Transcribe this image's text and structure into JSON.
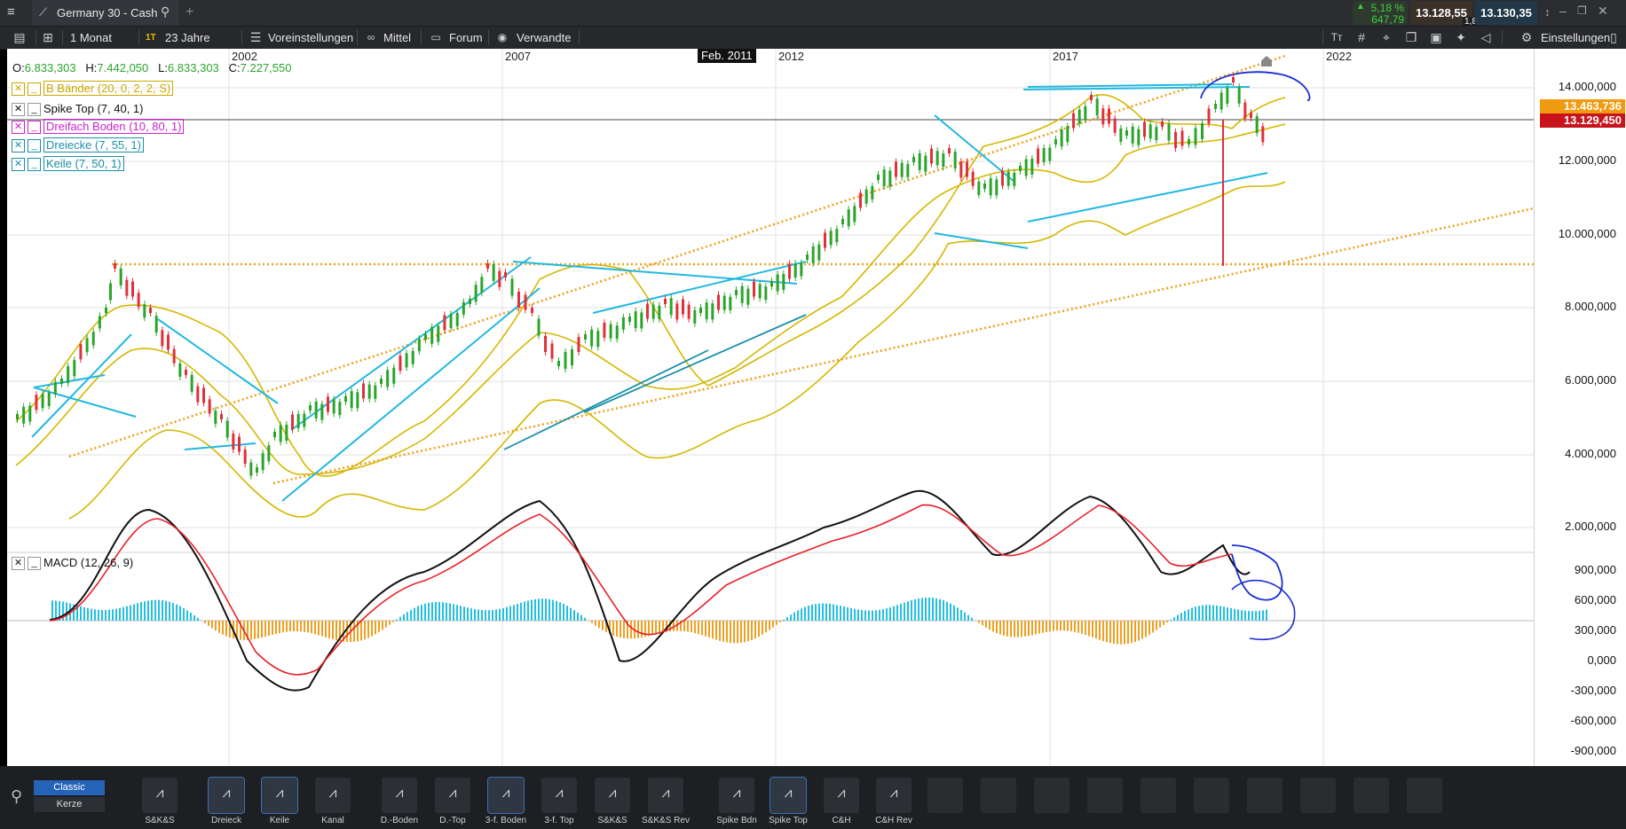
{
  "title_bar": {
    "menu_icon": "hamburger-icon",
    "chart_icon": "line-chart-icon",
    "instrument": "Germany 30 - Cash",
    "search_icon": "search-icon",
    "add_tab_icon": "plus-icon",
    "change_pct": "5,18 %",
    "change_abs": "647,79",
    "bid": "13.128,55",
    "ask": "13.130,35",
    "spread": "1,80",
    "window_controls": [
      "minimize-icon",
      "restore-icon",
      "close-icon"
    ]
  },
  "toolbar": {
    "interval": "1 Monat",
    "range_badge": "1T",
    "range": "23 Jahre",
    "presets": "Voreinstellungen",
    "average": "Mittel",
    "forum": "Forum",
    "related": "Verwandte",
    "settings": "Einstellungen"
  },
  "chart": {
    "ohlc": {
      "o_label": "O:",
      "o": "6.833,303",
      "h_label": "H:",
      "h": "7.442,050",
      "l_label": "L:",
      "l": "6.833,303",
      "c_label": "C:",
      "c": "7.227,550"
    },
    "cursor_date": "Feb. 2011",
    "x_ticks": [
      "2002",
      "2007",
      "2012",
      "2017",
      "2022"
    ],
    "y_ticks": [
      "14.000,000",
      "12.000,000",
      "10.000,000",
      "8.000,000",
      "6.000,000",
      "4.000,000",
      "2.000,000"
    ],
    "price_tags": {
      "upper_band": "13.463,736",
      "last": "13.129,450"
    },
    "indicators": [
      {
        "label": "B Bänder (20, 0, 2, 2, S)",
        "color": "#c9a800"
      },
      {
        "label": "Spike Top (7, 40, 1)",
        "color": "#111111"
      },
      {
        "label": "Dreifach Boden (10, 80, 1)",
        "color": "#cc22cc"
      },
      {
        "label": "Dreiecke (7, 55, 1)",
        "color": "#1a8fa8"
      },
      {
        "label": "Keile (7, 50, 1)",
        "color": "#1a8fa8"
      }
    ],
    "macd_label": "MACD (12, 26, 9)",
    "macd_ticks": [
      "900,000",
      "600,000",
      "300,000",
      "0,000",
      "-300,000",
      "-600,000",
      "-900,000"
    ],
    "colors": {
      "up": "#2aa52a",
      "down": "#e0303a",
      "bands": "#d4b800",
      "trend_orange": "#f0a020",
      "pattern_blue": "#22b8e0",
      "drawing_blue": "#1a2fd0"
    }
  },
  "bottom": {
    "search_icon": "search-icon",
    "style_classic": "Classic",
    "style_candle": "Kerze",
    "tools": [
      "S&K&S",
      "Dreieck",
      "Keile",
      "Kanal",
      "D.-Boden",
      "D.-Top",
      "3-f. Boden",
      "3-f. Top",
      "S&K&S",
      "S&K&S Rev",
      "Spike Bdn",
      "Spike Top",
      "C&H",
      "C&H Rev"
    ]
  }
}
